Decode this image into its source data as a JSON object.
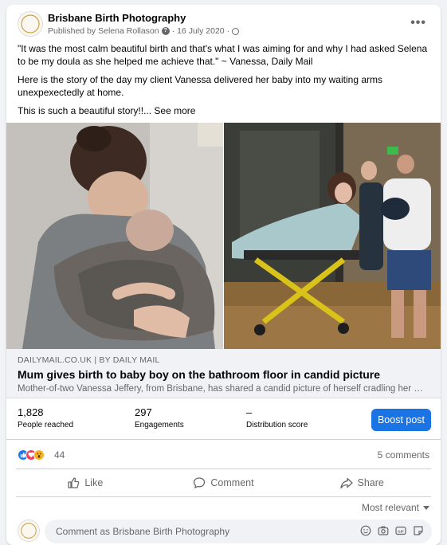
{
  "post": {
    "page_name": "Brisbane Birth Photography",
    "published_prefix": "Published by",
    "author": "Selena Rollason",
    "dot": "·",
    "date": "16 July 2020",
    "dot2": "·",
    "more": "•••",
    "paragraph1": "\"It was the most calm beautiful birth and that's what I was aiming for and why I had asked Selena to be my doula as she helped me achieve that.\" ~ Vanessa, Daily Mail",
    "paragraph2": "Here is the story of the day my client Vanessa delivered her baby into my waiting arms unexpexectedly at home.",
    "paragraph3": "This is such a beautiful story!!...",
    "see_more": "See more"
  },
  "link_preview": {
    "source": "DAILYMAIL.CO.UK | BY DAILY MAIL",
    "headline": "Mum gives birth to baby boy on the bathroom floor in candid picture",
    "description": "Mother-of-two Vanessa Jeffery, from Brisbane, has shared a candid picture of herself cradling her newborn son..."
  },
  "stats": {
    "people_reached_value": "1,828",
    "people_reached_label": "People reached",
    "engagements_value": "297",
    "engagements_label": "Engagements",
    "distribution_value": "–",
    "distribution_label": "Distribution score",
    "boost_label": "Boost post"
  },
  "reactions": {
    "count": "44",
    "comments": "5 comments",
    "icons": [
      "like-icon",
      "love-icon",
      "wow-icon"
    ],
    "colors": {
      "like": "#1877f2",
      "love": "#f33e58",
      "wow": "#f7b125"
    }
  },
  "actions": {
    "like": "Like",
    "comment": "Comment",
    "share": "Share"
  },
  "comments": {
    "sort_label": "Most relevant",
    "input_placeholder": "Comment as Brisbane Birth Photography"
  },
  "colors": {
    "accent": "#1b74e4",
    "muted": "#65676b"
  }
}
